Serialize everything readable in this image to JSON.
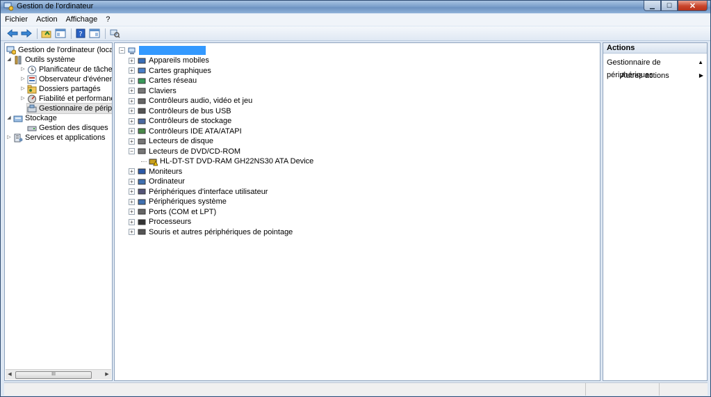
{
  "window": {
    "title": "Gestion de l'ordinateur"
  },
  "menubar": {
    "items": [
      "Fichier",
      "Action",
      "Affichage",
      "?"
    ]
  },
  "left_tree": [
    {
      "label": "Gestion de l'ordinateur (local)",
      "indent": 0,
      "toggle": "",
      "icon": "computer-management-icon"
    },
    {
      "label": "Outils système",
      "indent": 1,
      "toggle": "◢",
      "icon": "tools-icon"
    },
    {
      "label": "Planificateur de tâches",
      "indent": 2,
      "toggle": "▷",
      "icon": "clock-icon"
    },
    {
      "label": "Observateur d'événements",
      "indent": 2,
      "toggle": "▷",
      "icon": "event-viewer-icon"
    },
    {
      "label": "Dossiers partagés",
      "indent": 2,
      "toggle": "▷",
      "icon": "shared-folder-icon"
    },
    {
      "label": "Fiabilité et performances",
      "indent": 2,
      "toggle": "▷",
      "icon": "performance-icon"
    },
    {
      "label": "Gestionnaire de périphériques",
      "indent": 2,
      "toggle": "",
      "icon": "device-manager-icon",
      "selected": true
    },
    {
      "label": "Stockage",
      "indent": 0,
      "toggle": "◢",
      "icon": "storage-icon"
    },
    {
      "label": "Gestion des disques",
      "indent": 2,
      "toggle": "",
      "icon": "disk-icon"
    },
    {
      "label": "Services et applications",
      "indent": 0,
      "toggle": "▷",
      "icon": "services-icon"
    }
  ],
  "scrollbar": {
    "thumb_label": "III"
  },
  "devices": [
    {
      "label": "Appareils mobiles",
      "icon": "mobile-device-icon"
    },
    {
      "label": "Cartes graphiques",
      "icon": "display-adapter-icon"
    },
    {
      "label": "Cartes réseau",
      "icon": "network-adapter-icon"
    },
    {
      "label": "Claviers",
      "icon": "keyboard-icon"
    },
    {
      "label": "Contrôleurs audio, vidéo et jeu",
      "icon": "speaker-icon"
    },
    {
      "label": "Contrôleurs de bus USB",
      "icon": "usb-icon"
    },
    {
      "label": "Contrôleurs de stockage",
      "icon": "storage-controller-icon"
    },
    {
      "label": "Contrôleurs IDE ATA/ATAPI",
      "icon": "ide-controller-icon"
    },
    {
      "label": "Lecteurs de disque",
      "icon": "disk-drive-icon"
    },
    {
      "label": "Lecteurs de DVD/CD-ROM",
      "icon": "dvd-drive-icon",
      "expanded": true
    },
    {
      "label": "HL-DT-ST DVD-RAM GH22NS30 ATA Device",
      "icon": "dvd-warning-icon",
      "child": true
    },
    {
      "label": "Moniteurs",
      "icon": "monitor-icon"
    },
    {
      "label": "Ordinateur",
      "icon": "computer-icon"
    },
    {
      "label": "Périphériques d'interface utilisateur",
      "icon": "hid-icon"
    },
    {
      "label": "Périphériques système",
      "icon": "system-devices-icon"
    },
    {
      "label": "Ports (COM et LPT)",
      "icon": "port-icon"
    },
    {
      "label": "Processeurs",
      "icon": "processor-icon"
    },
    {
      "label": "Souris et autres périphériques de pointage",
      "icon": "mouse-icon"
    }
  ],
  "actions": {
    "header": "Actions",
    "section": "Gestionnaire de périphériques",
    "more": "Autres actions"
  }
}
